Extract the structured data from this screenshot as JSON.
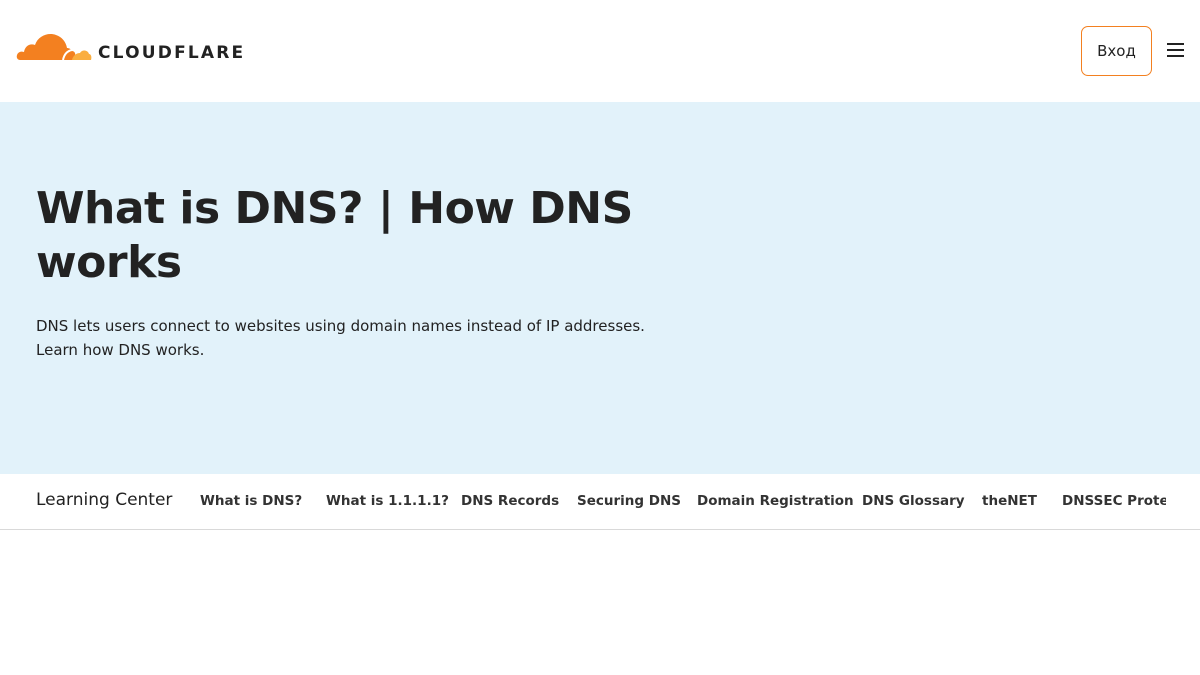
{
  "header": {
    "logo_text": "CLOUDFLARE",
    "login_label": "Вход",
    "menu_icon": "hamburger-menu-icon"
  },
  "hero": {
    "title": "What is DNS? | How DNS works",
    "description": "DNS lets users connect to websites using domain names instead of IP addresses. Learn how DNS works."
  },
  "subnav": {
    "title": "Learning Center",
    "items": [
      {
        "label": "What is DNS?"
      },
      {
        "label": "What is 1.1.1.1?"
      },
      {
        "label": "DNS Records"
      },
      {
        "label": "Securing DNS"
      },
      {
        "label": "Domain Registration"
      },
      {
        "label": "DNS Glossary"
      },
      {
        "label": "theNET"
      },
      {
        "label": "DNSSEC Protect"
      }
    ]
  },
  "colors": {
    "brand_orange": "#f38020",
    "brand_orange_light": "#faae40",
    "hero_bg": "#e2f2fa"
  }
}
